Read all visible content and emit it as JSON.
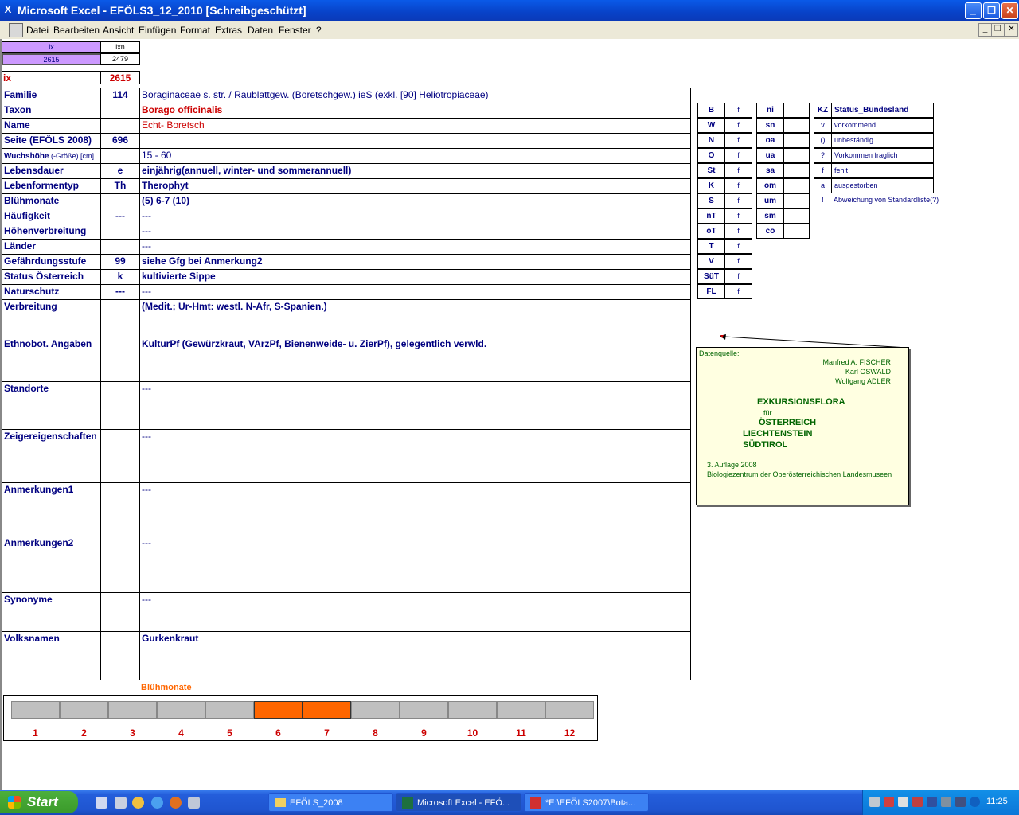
{
  "window": {
    "title": "Microsoft Excel - EFÖLS3_12_2010  [Schreibgeschützt]"
  },
  "menu": [
    "Datei",
    "Bearbeiten",
    "Ansicht",
    "Einfügen",
    "Format",
    "Extras",
    "Daten",
    "Fenster",
    "?"
  ],
  "top": {
    "ix_header": "ix",
    "ixn_header": "ixn",
    "ix_value": "2615",
    "ixn_value": "2479",
    "ix_label": "ix",
    "ix_red": "2615"
  },
  "rows": [
    {
      "label": "Familie",
      "code": "114",
      "value": "Boraginaceae s. str.  /  Raublattgew. (Boretschgew.) ieS (exkl. [90] Heliotropiaceae)"
    },
    {
      "label": "Taxon",
      "code": "",
      "value": "Borago officinalis"
    },
    {
      "label": "Name",
      "code": "",
      "value": "Echt- Boretsch"
    },
    {
      "label": "Seite (EFÖLS 2008)",
      "code": "696",
      "value": ""
    },
    {
      "label": "Wuchshöhe",
      "label_suffix": " (-Größe) [cm]",
      "code": "",
      "value": " 15 - 60"
    },
    {
      "label": "Lebensdauer",
      "code": "e",
      "value": "einjährig(annuell, winter- und sommerannuell)"
    },
    {
      "label": "Lebenformentyp",
      "code": "Th",
      "value": "Therophyt"
    },
    {
      "label": "Blühmonate",
      "code": "",
      "value": "(5) 6-7 (10)"
    },
    {
      "label": "Häufigkeit",
      "code": "---",
      "value": " ---"
    },
    {
      "label": "Höhenverbreitung",
      "code": "",
      "value": " ---"
    },
    {
      "label": "Länder",
      "code": "",
      "value": " ---"
    },
    {
      "label": "Gefährdungsstufe",
      "code": "99",
      "value": "siehe Gfg bei Anmerkung2"
    },
    {
      "label": "Status Österreich",
      "code": "k",
      "value": "kultivierte Sippe"
    },
    {
      "label": "Naturschutz",
      "code": "---",
      "value": " ---"
    },
    {
      "label": "Verbreitung",
      "code": "",
      "value": "(Medit.; Ur-Hmt: westl. N-Afr, S-Spanien.)"
    },
    {
      "label": "Ethnobot. Angaben",
      "code": "",
      "value": "KulturPf (Gewürzkraut, VArzPf, Bienenweide- u. ZierPf), gelegentlich verwld."
    },
    {
      "label": "Standorte",
      "code": "",
      "value": "---"
    },
    {
      "label": "Zeigereigenschaften",
      "code": "",
      "value": "---"
    },
    {
      "label": "Anmerkungen1",
      "code": "",
      "value": "---"
    },
    {
      "label": "Anmerkungen2",
      "code": "",
      "value": "---"
    },
    {
      "label": "Synonyme",
      "code": "",
      "value": "---"
    },
    {
      "label": "Volksnamen",
      "code": "",
      "value": "Gurkenkraut"
    }
  ],
  "legend1": [
    {
      "k": "B",
      "v": "f"
    },
    {
      "k": "W",
      "v": "f"
    },
    {
      "k": "N",
      "v": "f"
    },
    {
      "k": "O",
      "v": "f"
    },
    {
      "k": "St",
      "v": "f"
    },
    {
      "k": "K",
      "v": "f"
    },
    {
      "k": "S",
      "v": "f"
    },
    {
      "k": "nT",
      "v": "f"
    },
    {
      "k": "oT",
      "v": "f"
    },
    {
      "k": "T",
      "v": "f"
    },
    {
      "k": "V",
      "v": "f"
    },
    {
      "k": "SüT",
      "v": "f"
    },
    {
      "k": "FL",
      "v": "f"
    }
  ],
  "legend2": [
    "ni",
    "sn",
    "oa",
    "ua",
    "sa",
    "om",
    "um",
    "sm",
    "co"
  ],
  "legend3": {
    "header": {
      "k": "KZ",
      "v": "Status_Bundesland"
    },
    "rows": [
      {
        "k": "v",
        "v": "vorkommend"
      },
      {
        "k": "()",
        "v": "unbeständig"
      },
      {
        "k": "?",
        "v": "Vorkommen fraglich"
      },
      {
        "k": "f",
        "v": "fehlt"
      },
      {
        "k": "a",
        "v": "ausgestorben"
      },
      {
        "k": "!",
        "v": "Abweichung von Standardliste(?)"
      }
    ]
  },
  "note": {
    "line1": "Datenquelle:",
    "author1": "Manfred A. FISCHER",
    "author2": "Karl OSWALD",
    "author3": "Wolfgang ADLER",
    "title1": "EXKURSIONSFLORA",
    "title2": "für",
    "title3": "ÖSTERREICH",
    "title4": "LIECHTENSTEIN",
    "title5": "SÜDTIROL",
    "edition": "3. Auflage 2008",
    "publisher": "Biologiezentrum der Oberösterreichischen Landesmuseen"
  },
  "chart_data": {
    "type": "bar",
    "title": "Blühmonate",
    "categories": [
      "1",
      "2",
      "3",
      "4",
      "5",
      "6",
      "7",
      "8",
      "9",
      "10",
      "11",
      "12"
    ],
    "values": [
      0,
      0,
      0,
      0,
      0,
      1,
      1,
      0,
      0,
      0,
      0,
      0
    ],
    "colors": {
      "active": "#ff6600",
      "inactive": "#c0c0c0"
    }
  },
  "taskbar": {
    "start": "Start",
    "tasks": [
      "EFÖLS_2008",
      "Microsoft Excel - EFÖ...",
      "*E:\\EFÖLS2007\\Bota..."
    ],
    "clock": "11:25"
  }
}
